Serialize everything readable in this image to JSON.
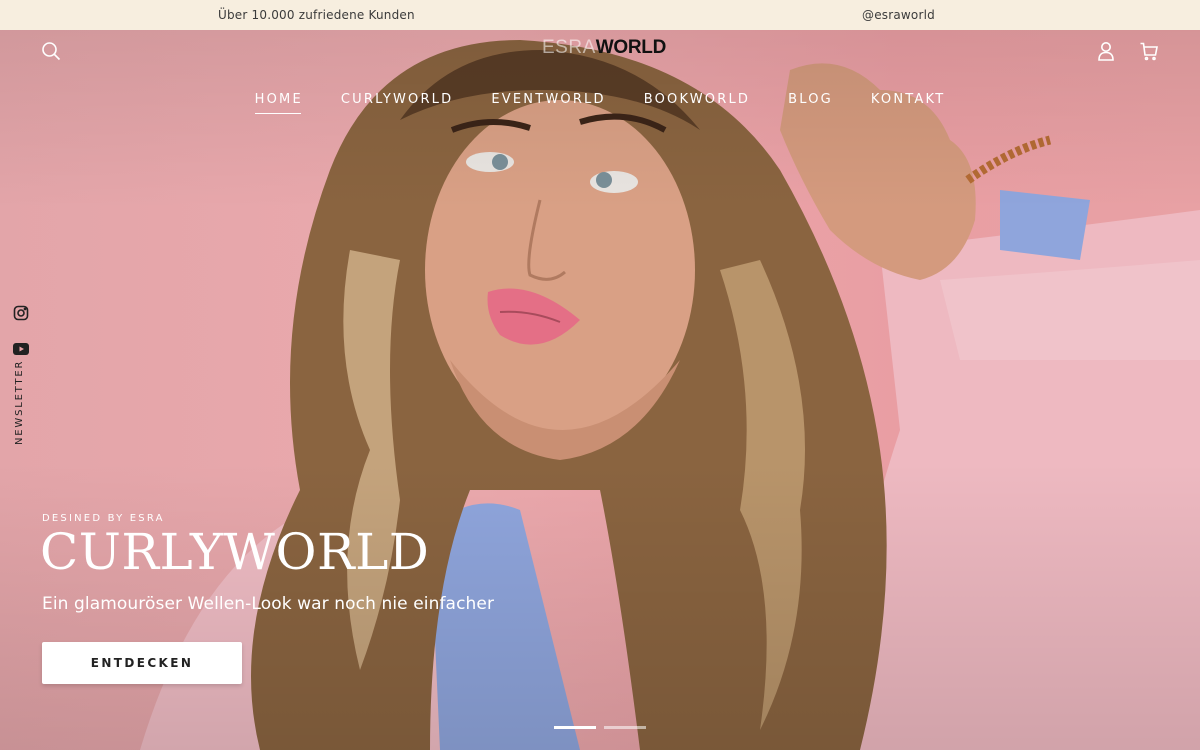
{
  "announcement": {
    "left_text": "Über 10.000 zufriedene Kunden",
    "right_text": "@esraworld"
  },
  "header": {
    "logo_light": "ESRA",
    "logo_bold": "WORLD",
    "icons": [
      "search-icon",
      "account-icon",
      "cart-icon"
    ]
  },
  "nav": {
    "items": [
      {
        "label": "HOME",
        "active": true
      },
      {
        "label": "CURLYWORLD",
        "active": false
      },
      {
        "label": "EVENTWORLD",
        "active": false
      },
      {
        "label": "BOOKWORLD",
        "active": false
      },
      {
        "label": "BLOG",
        "active": false
      },
      {
        "label": "KONTAKT",
        "active": false
      }
    ]
  },
  "social": {
    "icons": [
      "instagram-icon",
      "youtube-icon"
    ],
    "newsletter_label": "NEWSLETTER"
  },
  "hero": {
    "kicker": "DESINED BY ESRA",
    "title": "CURLYWORLD",
    "subtitle": "Ein glamouröser Wellen-Look war noch nie einfacher",
    "cta_label": "ENTDECKEN",
    "slides_total": 2,
    "slide_active": 1
  },
  "colors": {
    "announcement_bg": "#f7eedf",
    "hero_bg": "#e9a3a8",
    "text_light": "#ffffff"
  }
}
